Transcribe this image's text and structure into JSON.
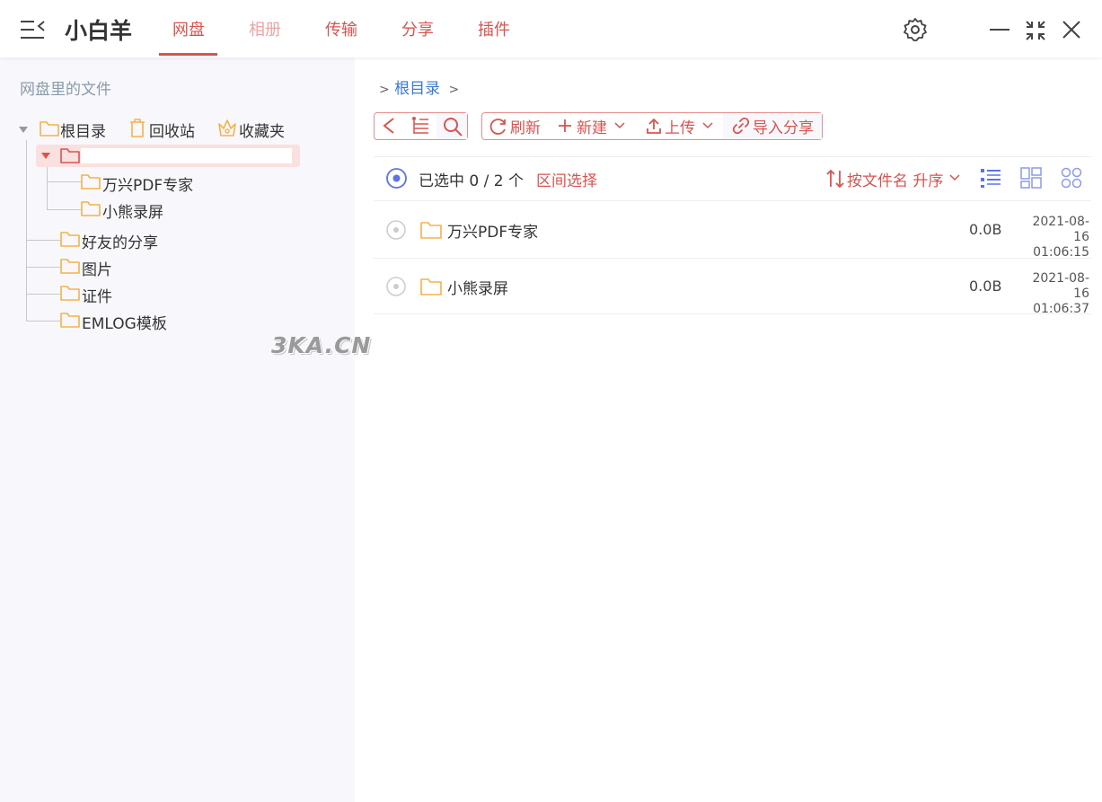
{
  "app": {
    "title": "小白羊"
  },
  "tabs": [
    "网盘",
    "相册",
    "传输",
    "分享",
    "插件"
  ],
  "icons": {
    "menu": "menu-collapse-icon",
    "settings": "gear-icon",
    "minimize": "minimize-icon",
    "maximize": "maximize-icon",
    "close": "close-icon"
  },
  "sidebar": {
    "title": "网盘里的文件",
    "root": "根目录",
    "trash": "回收站",
    "favorites": "收藏夹",
    "children_of_selected": [
      "万兴PDF专家",
      "小熊录屏"
    ],
    "folders": [
      "好友的分享",
      "图片",
      "证件",
      "EMLOG模板"
    ]
  },
  "breadcrumb": {
    "prefix": ">",
    "root": "根目录",
    "suffix": ">"
  },
  "toolbar": {
    "refresh": "刷新",
    "new": "新建",
    "upload": "上传",
    "import_share": "导入分享"
  },
  "selection": {
    "text": "已选中 0 / 2 个",
    "range_select": "区间选择",
    "sort": "按文件名 升序"
  },
  "files": [
    {
      "name": "万兴PDF专家",
      "size": "0.0B",
      "date": "2021-08-16",
      "time": "01:06:15"
    },
    {
      "name": "小熊录屏",
      "size": "0.0B",
      "date": "2021-08-16",
      "time": "01:06:37"
    }
  ],
  "watermark": "3KA.CN",
  "colors": {
    "accent": "#d9534f",
    "accent_muted": "#eaa5a3",
    "folder": "#f5b14a",
    "select_blue": "#5b73e8",
    "link_blue": "#3a7bd5"
  }
}
